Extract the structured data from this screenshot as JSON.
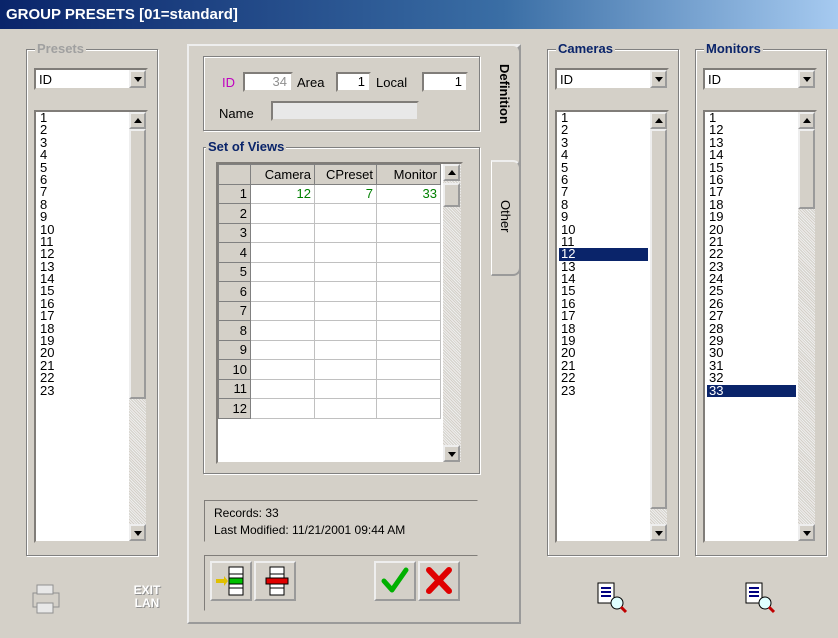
{
  "window": {
    "title": "GROUP PRESETS  [01=standard]"
  },
  "presets": {
    "label": "Presets",
    "combo_value": "ID",
    "items": [
      "1",
      "2",
      "3",
      "4",
      "5",
      "6",
      "7",
      "8",
      "9",
      "10",
      "11",
      "12",
      "13",
      "14",
      "15",
      "16",
      "17",
      "18",
      "19",
      "20",
      "21",
      "22",
      "23"
    ]
  },
  "definition": {
    "id_label": "ID",
    "id_value": "34",
    "area_label": "Area",
    "area_value": "1",
    "local_label": "Local",
    "local_value": "1",
    "name_label": "Name",
    "name_value": "",
    "views_label": "Set of Views",
    "columns": [
      "Camera",
      "CPreset",
      "Monitor"
    ],
    "rows": [
      {
        "n": "1",
        "camera": "12",
        "cpreset": "7",
        "monitor": "33"
      },
      {
        "n": "2",
        "camera": "",
        "cpreset": "",
        "monitor": ""
      },
      {
        "n": "3",
        "camera": "",
        "cpreset": "",
        "monitor": ""
      },
      {
        "n": "4",
        "camera": "",
        "cpreset": "",
        "monitor": ""
      },
      {
        "n": "5",
        "camera": "",
        "cpreset": "",
        "monitor": ""
      },
      {
        "n": "6",
        "camera": "",
        "cpreset": "",
        "monitor": ""
      },
      {
        "n": "7",
        "camera": "",
        "cpreset": "",
        "monitor": ""
      },
      {
        "n": "8",
        "camera": "",
        "cpreset": "",
        "monitor": ""
      },
      {
        "n": "9",
        "camera": "",
        "cpreset": "",
        "monitor": ""
      },
      {
        "n": "10",
        "camera": "",
        "cpreset": "",
        "monitor": ""
      },
      {
        "n": "11",
        "camera": "",
        "cpreset": "",
        "monitor": ""
      },
      {
        "n": "12",
        "camera": "",
        "cpreset": "",
        "monitor": ""
      }
    ],
    "records": "Records:  33",
    "last_modified": "Last Modified:  11/21/2001 09:44 AM"
  },
  "tabs": {
    "definition": "Definition",
    "other": "Other"
  },
  "cameras": {
    "label": "Cameras",
    "combo_value": "ID",
    "items": [
      "1",
      "2",
      "3",
      "4",
      "5",
      "6",
      "7",
      "8",
      "9",
      "10",
      "11",
      "12",
      "13",
      "14",
      "15",
      "16",
      "17",
      "18",
      "19",
      "20",
      "21",
      "22",
      "23"
    ],
    "selected": "12"
  },
  "monitors": {
    "label": "Monitors",
    "combo_value": "ID",
    "items": [
      "1",
      "12",
      "13",
      "14",
      "15",
      "16",
      "17",
      "18",
      "19",
      "20",
      "21",
      "22",
      "23",
      "24",
      "25",
      "26",
      "27",
      "28",
      "29",
      "30",
      "31",
      "32",
      "33"
    ],
    "selected": "33"
  },
  "buttons": {
    "exit_line1": "EXIT",
    "exit_line2": "LAN"
  },
  "colors": {
    "title_bar": "#0a246a",
    "selection": "#0a246a",
    "grid_values": "#008000",
    "id_label": "#c000c0"
  }
}
